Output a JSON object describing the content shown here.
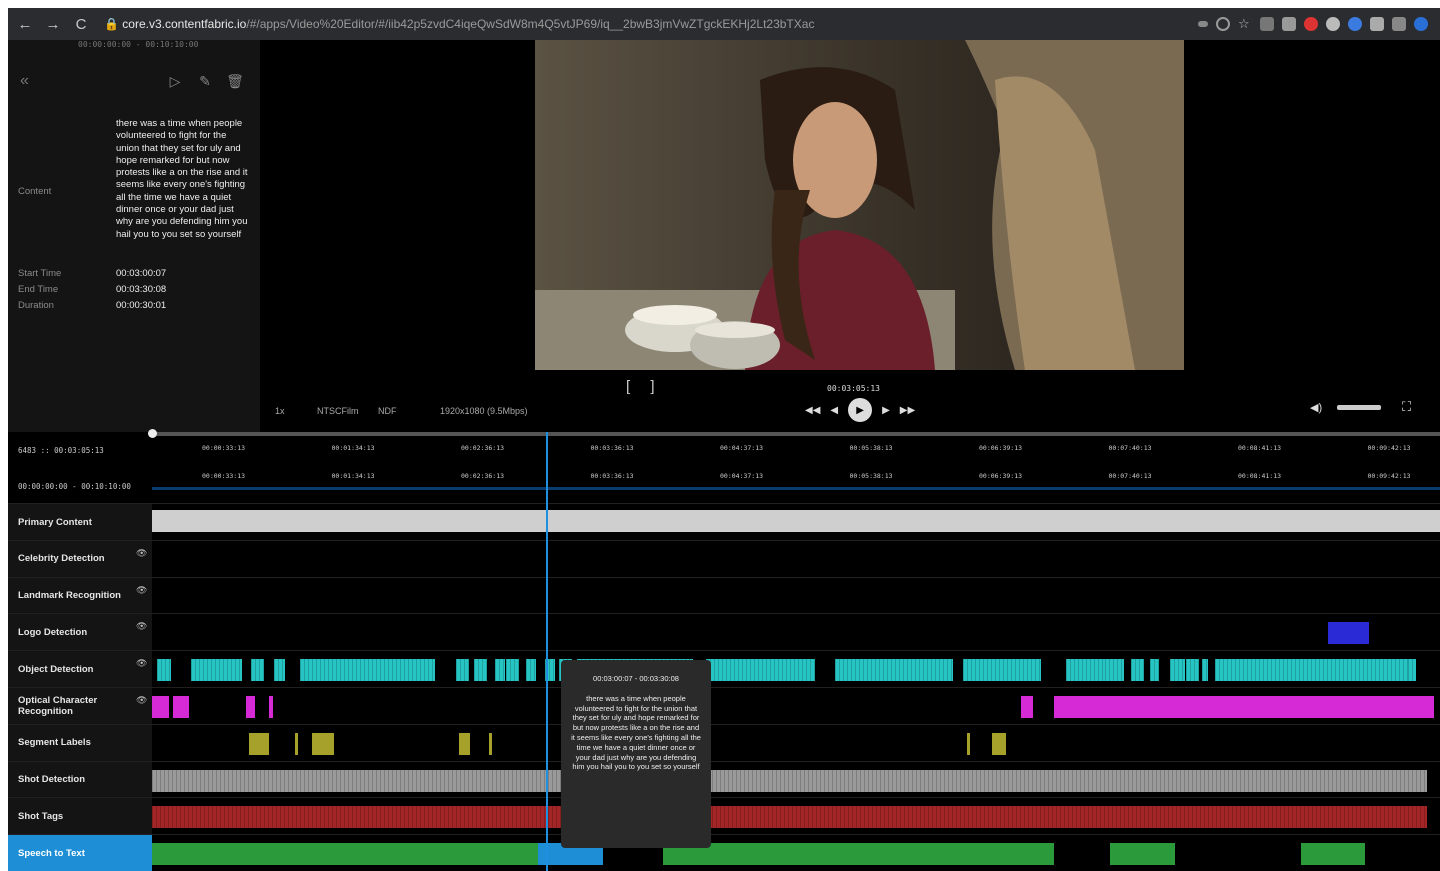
{
  "browser": {
    "url_host": "core.v3.contentfabric.io",
    "url_path": "/#/apps/Video%20Editor/#/iib42p5zvdC4iqeQwSdW8m4Q5vtJP69/iq__2bwB3jmVwZTgckEKHj2Lt23bTXac",
    "back_icon": "←",
    "forward_icon": "→",
    "reload_icon": "C"
  },
  "left_panel": {
    "range": "00:00:00:00 - 00:10:10:00",
    "content_label": "Content",
    "content_text": "there was a time when people volunteered to fight for the union that they set for uly and hope remarked for but now protests like a on the rise and it seems like every one's fighting all the time we have a quiet dinner once or your dad just why are you defending him you hail you to you set so yourself",
    "start_label": "Start Time",
    "start_value": "00:03:00:07",
    "end_label": "End Time",
    "end_value": "00:03:30:08",
    "duration_label": "Duration",
    "duration_value": "00:00:30:01"
  },
  "player": {
    "speed": "1x",
    "rate": "NTSCFilm",
    "drop": "NDF",
    "resolution": "1920x1080 (9.5Mbps)",
    "timecode": "00:03:05:13"
  },
  "timeline": {
    "top_label": "6483 :: 00:03:05:13",
    "bottom_label": "00:00:00:00 - 00:10:10:00",
    "ticks": [
      "00:00:33:13",
      "00:01:34:13",
      "00:02:36:13",
      "00:03:36:13",
      "00:04:37:13",
      "00:05:38:13",
      "00:06:39:13",
      "00:07:40:13",
      "00:08:41:13",
      "00:09:42:13"
    ],
    "tracks": [
      {
        "label": "Primary Content",
        "eye": false,
        "color": "#cfcfcf"
      },
      {
        "label": "Celebrity Detection",
        "eye": true,
        "color": ""
      },
      {
        "label": "Landmark Recognition",
        "eye": true,
        "color": ""
      },
      {
        "label": "Logo Detection",
        "eye": true,
        "color": "#2a2ad6"
      },
      {
        "label": "Object Detection",
        "eye": true,
        "color": "#27c4c4"
      },
      {
        "label": "Optical Character Recognition",
        "eye": true,
        "color": "#d62ad6"
      },
      {
        "label": "Segment Labels",
        "eye": false,
        "color": "#a6a12b"
      },
      {
        "label": "Shot Detection",
        "eye": false,
        "color": "#9a9a9a"
      },
      {
        "label": "Shot Tags",
        "eye": false,
        "color": "#a32525"
      },
      {
        "label": "Speech to Text",
        "eye": false,
        "color": "#2a9a3a",
        "active": true
      }
    ]
  },
  "tooltip": {
    "time": "00:03:00:07 - 00:03:30:08",
    "text": "there was a time when people volunteered to fight for the union that they set for uly and hope remarked for but now protests like a on the rise and it seems like every one's fighting all the time we have a quiet dinner once or your dad just why are you defending him you hail you to you set so yourself"
  }
}
